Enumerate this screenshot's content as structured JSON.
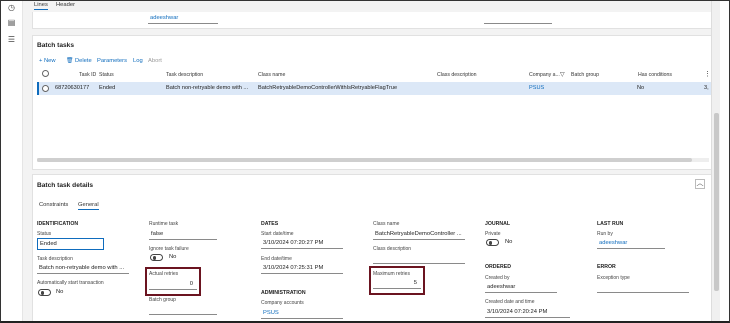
{
  "top_tabs": [
    {
      "label": "Lines"
    },
    {
      "label": "Header"
    }
  ],
  "top_user": "adeeshwar",
  "batch_tasks": {
    "title": "Batch tasks",
    "actions": {
      "new": "New",
      "delete": "Delete",
      "parameters": "Parameters",
      "log": "Log",
      "abort": "Abort"
    },
    "columns": [
      "Task ID",
      "Status",
      "Task description",
      "Class name",
      "Class description",
      "Company a...",
      "Batch group",
      "Has conditions"
    ],
    "rows": [
      {
        "task_id": "68720630177",
        "status": "Ended",
        "description": "Batch non-retryable demo with ...",
        "class_name": "BatchRetryableDemoControllerWithIsRetryableFlagTrue",
        "class_description": "",
        "company": "PSUS",
        "batch_group": "",
        "has_conditions": "No",
        "overflow": "3,"
      }
    ]
  },
  "details": {
    "title": "Batch task details",
    "tabs": [
      {
        "label": "Constraints"
      },
      {
        "label": "General"
      }
    ],
    "identification": {
      "header": "IDENTIFICATION",
      "status_label": "Status",
      "status_value": "Ended",
      "task_desc_label": "Task description",
      "task_desc_value": "Batch non-retryable demo with ...",
      "auto_start_label": "Automatically start transaction",
      "auto_start_value": "No"
    },
    "runtime": {
      "runtime_label": "Runtime task",
      "runtime_value": "false",
      "ignore_label": "Ignore task failure",
      "ignore_value": "No",
      "actual_retries_label": "Actual retries",
      "actual_retries_value": "0",
      "batch_group_label": "Batch group"
    },
    "dates": {
      "header": "DATES",
      "start_label": "Start date/time",
      "start_value": "3/10/2024 07:20:27 PM",
      "end_label": "End date/time",
      "end_value": "3/10/2024 07:25:31 PM"
    },
    "administration": {
      "header": "ADMINISTRATION",
      "company_label": "Company accounts",
      "company_value": "PSUS"
    },
    "class": {
      "class_name_label": "Class name",
      "class_name_value": "BatchRetryableDemoController ...",
      "class_desc_label": "Class description",
      "max_retries_label": "Maximum retries",
      "max_retries_value": "5"
    },
    "journal": {
      "header": "JOURNAL",
      "private_label": "Private",
      "private_value": "No"
    },
    "ordered": {
      "header": "ORDERED",
      "created_by_label": "Created by",
      "created_by_value": "adeeshwar",
      "created_dt_label": "Created date and time",
      "created_dt_value": "3/10/2024 07:20:24 PM"
    },
    "last_run": {
      "header": "LAST RUN",
      "run_by_label": "Run by",
      "run_by_value": "adeeshwar"
    },
    "error": {
      "header": "ERROR",
      "exception_label": "Exception type"
    }
  },
  "colors": {
    "accent": "#0f6cbd",
    "highlight_box": "#6b1420",
    "row_selected": "#dce8f7"
  }
}
